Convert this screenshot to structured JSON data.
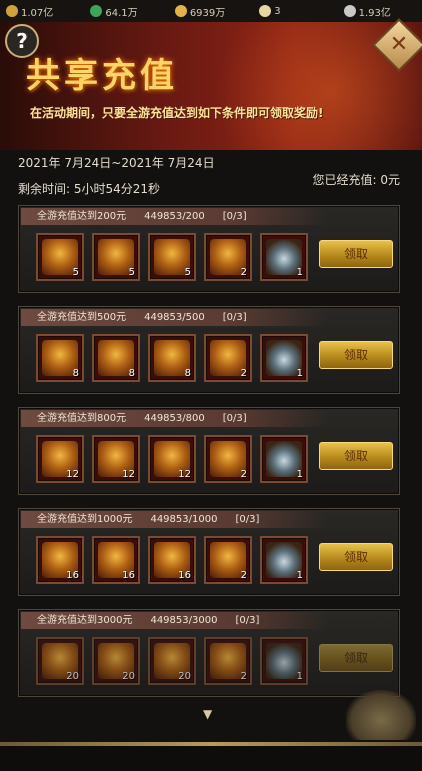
{
  "resources": [
    {
      "value": "1.07亿",
      "icon": "gold-ingot-icon",
      "color": "#d2a23a"
    },
    {
      "value": "64.1万",
      "icon": "jade-icon",
      "color": "#3fa35a"
    },
    {
      "value": "6939万",
      "icon": "coin-icon",
      "color": "#e0b44a"
    },
    {
      "value": "3",
      "icon": "feather-icon",
      "color": "#e8d6a0"
    },
    {
      "value": "1.93亿",
      "icon": "silver-icon",
      "color": "#c8c8c8"
    }
  ],
  "banner": {
    "title": "共享充值",
    "subtitle": "在活动期间，只要全游充值达到如下条件即可领取奖励!"
  },
  "info": {
    "date_range": "2021年 7月24日~2021年 7月24日",
    "remaining": "剩余时间:  5小时54分21秒",
    "recharged": "您已经充值:  0元"
  },
  "tiers": [
    {
      "title": "全游充值达到200元",
      "progress": "449853/200",
      "claims": "[0/3]",
      "counts": [
        "5",
        "5",
        "5",
        "2",
        "1"
      ],
      "button": "领取"
    },
    {
      "title": "全游充值达到500元",
      "progress": "449853/500",
      "claims": "[0/3]",
      "counts": [
        "8",
        "8",
        "8",
        "2",
        "1"
      ],
      "button": "领取"
    },
    {
      "title": "全游充值达到800元",
      "progress": "449853/800",
      "claims": "[0/3]",
      "counts": [
        "12",
        "12",
        "12",
        "2",
        "1"
      ],
      "button": "领取"
    },
    {
      "title": "全游充值达到1000元",
      "progress": "449853/1000",
      "claims": "[0/3]",
      "counts": [
        "16",
        "16",
        "16",
        "2",
        "1"
      ],
      "button": "领取"
    },
    {
      "title": "全游充值达到3000元",
      "progress": "449853/3000",
      "claims": "[0/3]",
      "counts": [
        "20",
        "20",
        "20",
        "2",
        "1"
      ],
      "button": "领取"
    }
  ],
  "icons": {
    "help": "?",
    "close": "✕"
  }
}
